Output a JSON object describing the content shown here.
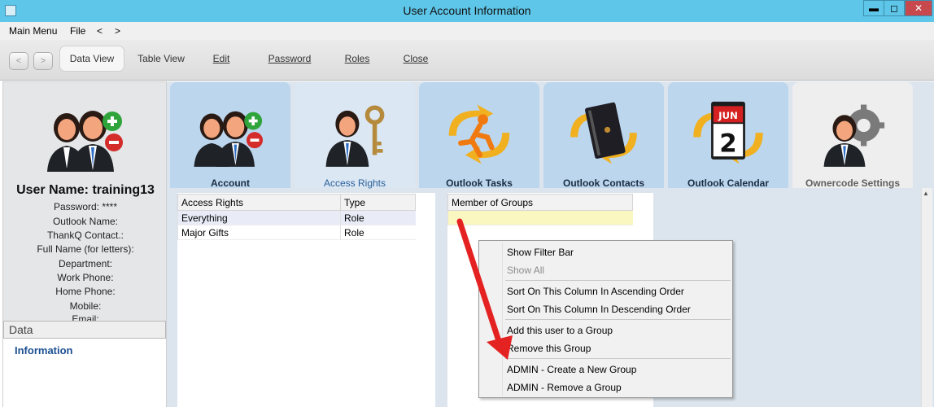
{
  "window": {
    "title": "User Account Information",
    "minimize": "▬",
    "maximize": "◻",
    "close": "✕"
  },
  "menu": {
    "main_menu": "Main Menu",
    "file": "File",
    "back": "<",
    "forward": ">"
  },
  "toolbar": {
    "back": "<",
    "forward": ">",
    "data_view": "Data View",
    "table_view": "Table View",
    "edit": "Edit",
    "password": "Password",
    "roles": "Roles",
    "close": "Close"
  },
  "profile": {
    "username": "User Name: training13",
    "password": "Password: ****",
    "outlook_name": "Outlook Name:",
    "thankq_contact": "ThankQ Contact.:",
    "full_name": "Full Name (for letters):",
    "department": "Department:",
    "work_phone": "Work Phone:",
    "home_phone": "Home Phone:",
    "mobile": "Mobile:",
    "email": "Email:"
  },
  "sidebar": {
    "section": "Data",
    "information": "Information"
  },
  "tabs": [
    {
      "label": "Account",
      "icon": "users-add-remove-icon"
    },
    {
      "label": "Access Rights",
      "icon": "user-key-icon"
    },
    {
      "label": "Outlook Tasks",
      "icon": "tasks-sync-icon"
    },
    {
      "label": "Outlook Contacts",
      "icon": "contacts-sync-icon"
    },
    {
      "label": "Outlook Calendar",
      "icon": "calendar-sync-icon"
    },
    {
      "label": "Ownercode Settings",
      "icon": "user-gear-icon"
    }
  ],
  "calendar_icon": {
    "month": "JUN",
    "day": "2"
  },
  "access_rights": {
    "columns": [
      "Access Rights",
      "Type"
    ],
    "rows": [
      [
        "Everything",
        "Role"
      ],
      [
        "Major Gifts",
        "Role"
      ]
    ]
  },
  "groups": {
    "columns": [
      "Member of Groups"
    ]
  },
  "context_menu": {
    "items": [
      {
        "label": "Show Filter Bar",
        "enabled": true
      },
      {
        "label": "Show All",
        "enabled": false
      },
      {
        "label": "Sort On This Column In Ascending Order",
        "enabled": true
      },
      {
        "label": "Sort On This Column In Descending Order",
        "enabled": true
      },
      {
        "label": "Add this user to a Group",
        "enabled": true
      },
      {
        "label": "Remove this Group",
        "enabled": true
      },
      {
        "label": "ADMIN - Create a New Group",
        "enabled": true
      },
      {
        "label": "ADMIN - Remove a Group",
        "enabled": true
      }
    ]
  },
  "colors": {
    "titlebar": "#5ec6e8",
    "close_button": "#c7494d",
    "tab_selected_text": "#2b5f9b",
    "arrow": "#e52222"
  }
}
